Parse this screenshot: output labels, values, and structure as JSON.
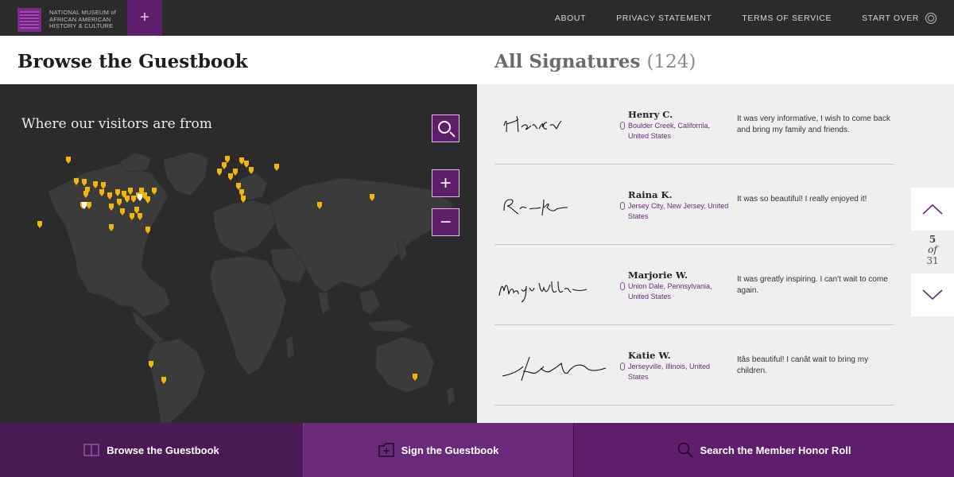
{
  "header": {
    "logo_text": "NATIONAL MUSEUM of AFRICAN AMERICAN HISTORY & CULTURE",
    "plus_label": "+",
    "nav": [
      "ABOUT",
      "PRIVACY STATEMENT",
      "TERMS OF SERVICE",
      "START OVER"
    ]
  },
  "left": {
    "title": "Browse the Guestbook",
    "map_title": "Where our visitors are from",
    "zoom_in": "+",
    "zoom_out": "−",
    "icons": [
      "search-icon",
      "plus-icon",
      "minus-icon"
    ]
  },
  "right": {
    "title": "All Signatures",
    "count": "(124)",
    "signatures": [
      {
        "name": "Henry C.",
        "location": "Boulder Creek, California, United States",
        "message": "It was very informative, I wish to come back and bring my family and friends."
      },
      {
        "name": "Raina K.",
        "location": "Jersey City, New Jersey, United States",
        "message": "It was so beautiful! I really enjoyed it!"
      },
      {
        "name": "Marjorie W.",
        "location": "Union Dale, Pennsylvania, United States",
        "message": "It was greatly inspiring. I can't wait to come again."
      },
      {
        "name": "Katie W.",
        "location": "Jerseyville, Illinois, United States",
        "message": "Itâs beautiful! I canât wait to bring my children."
      }
    ],
    "pager": {
      "current": "5",
      "of": "of",
      "total": "31"
    }
  },
  "bottom": {
    "tabs": [
      "Browse the Guestbook",
      "Sign the Guestbook",
      "Search the Member Honor Roll"
    ]
  },
  "colors": {
    "accent_purple": "#5e1e6b",
    "pin_yellow": "#f2b705",
    "dark_bg": "#2b2b2b"
  }
}
